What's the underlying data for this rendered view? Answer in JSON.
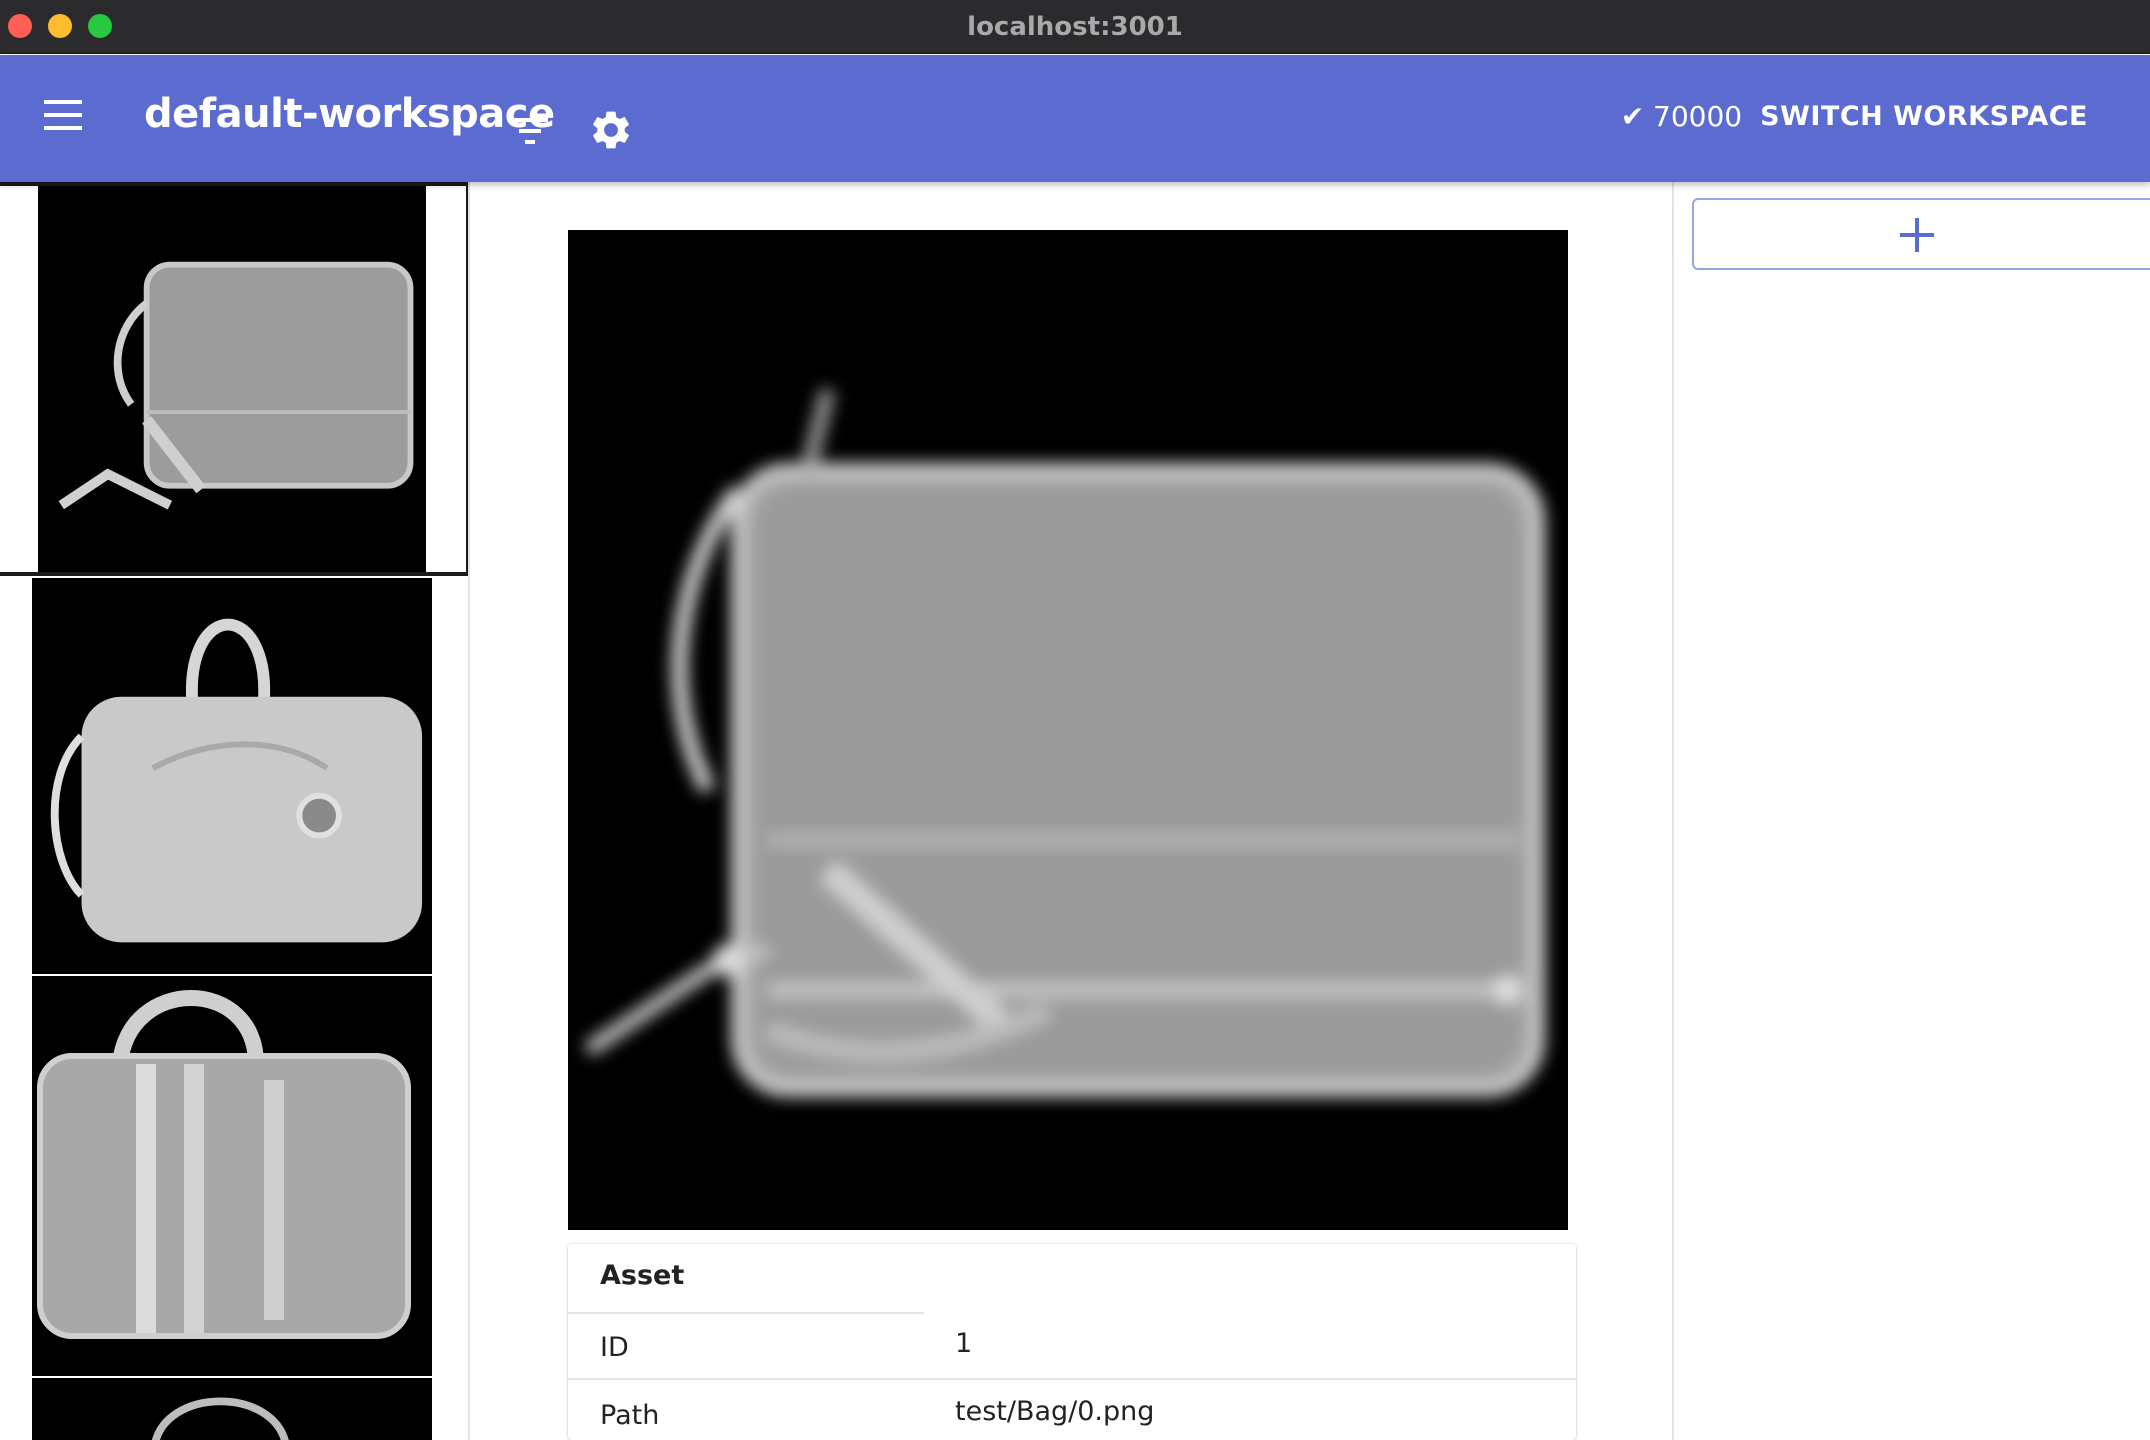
{
  "window": {
    "title": "localhost:3001"
  },
  "appbar": {
    "workspace_title": "default-workspace",
    "count_text": "✔ 70000",
    "switch_label": "SWITCH WORKSPACE",
    "icons": [
      "menu-icon",
      "filter-icon",
      "gear-icon"
    ],
    "color": "#5c6bcf"
  },
  "thumbnails": [
    {
      "description_icon": "bag-thumbnail",
      "selected": true
    },
    {
      "description_icon": "bag-thumbnail",
      "selected": false
    },
    {
      "description_icon": "bag-thumbnail",
      "selected": false
    },
    {
      "description_icon": "bag-thumbnail",
      "selected": false
    }
  ],
  "asset_card": {
    "header": "Asset",
    "rows": [
      {
        "key": "ID",
        "value": "1"
      },
      {
        "key": "Path",
        "value": "test/Bag/0.png"
      }
    ]
  },
  "right_panel": {
    "add_icon": "plus-icon"
  }
}
